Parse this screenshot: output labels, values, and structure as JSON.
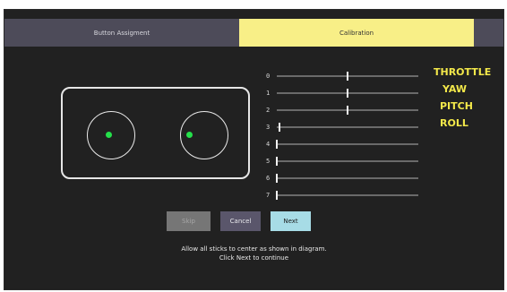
{
  "tabs": [
    {
      "label": "Button Assigment",
      "active": false
    },
    {
      "label": "Calibration",
      "active": true
    }
  ],
  "colors": {
    "background": "#212121",
    "tab_inactive": "#4d4b59",
    "tab_active": "#f8ef87",
    "channel_name": "#f3e84a",
    "stick_dot": "#24e04a",
    "next_button": "#a7dce6",
    "cancel_button": "#5a566b",
    "skip_button": "#767676"
  },
  "channels": [
    {
      "number": "0",
      "name": "THROTTLE",
      "level": 0.5
    },
    {
      "number": "1",
      "name": "YAW",
      "level": 0.5
    },
    {
      "number": "2",
      "name": "PITCH",
      "level": 0.5
    },
    {
      "number": "3",
      "name": "ROLL",
      "level": 0.02
    },
    {
      "number": "4",
      "name": "",
      "level": 0
    },
    {
      "number": "5",
      "name": "",
      "level": 0
    },
    {
      "number": "6",
      "name": "",
      "level": 0
    },
    {
      "number": "7",
      "name": "",
      "level": 0
    }
  ],
  "buttons": {
    "skip": "Skip",
    "cancel": "Cancel",
    "next": "Next"
  },
  "instructions": {
    "line1": "Allow all sticks to center as shown in diagram.",
    "line2": "Click Next to continue"
  }
}
